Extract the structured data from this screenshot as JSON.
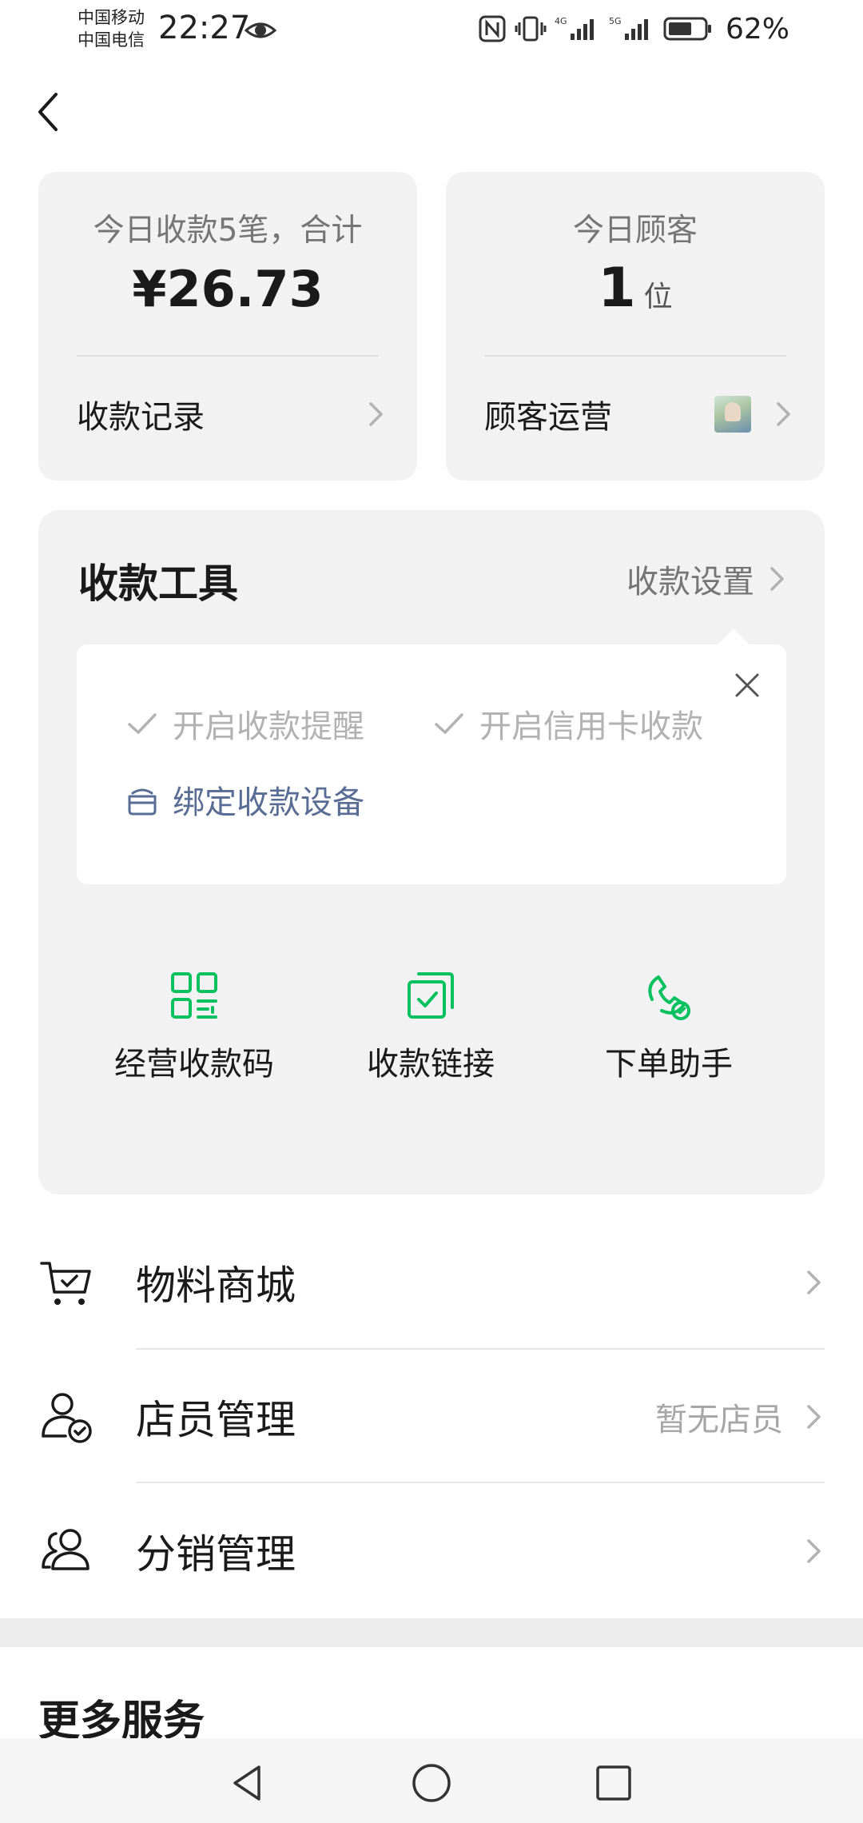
{
  "status_bar": {
    "carrier_1": "中国移动",
    "carrier_2": "中国电信",
    "time": "22:27",
    "battery": "62%"
  },
  "summary": {
    "payments_caption": "今日收款5笔，合计",
    "payments_amount": "¥26.73",
    "payments_link": "收款记录",
    "customers_caption": "今日顾客",
    "customers_count": "1",
    "customers_unit": "位",
    "customers_link": "顾客运营"
  },
  "tools": {
    "title": "收款工具",
    "settings_label": "收款设置",
    "tips": {
      "reminder": "开启收款提醒",
      "credit_card": "开启信用卡收款",
      "bind_device": "绑定收款设备"
    },
    "buttons": {
      "qr_code": "经营收款码",
      "payment_link": "收款链接",
      "order_assistant": "下单助手"
    }
  },
  "menu": {
    "materials_mall": "物料商城",
    "staff_management": "店员管理",
    "staff_hint": "暂无店员",
    "distribution_management": "分销管理"
  },
  "more_services": "更多服务",
  "colors": {
    "accent_green": "#07c160",
    "link_blue": "#586c94",
    "card_bg": "#f2f2f2"
  }
}
